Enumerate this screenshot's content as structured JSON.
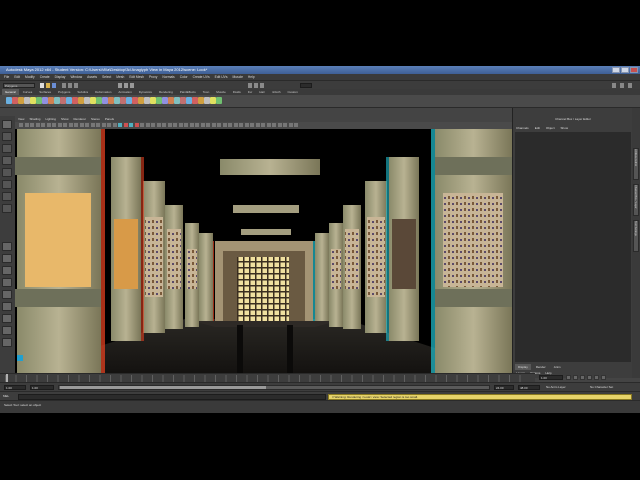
{
  "window": {
    "title": "Autodesk Maya 2012 x64 - Student Version: C:\\Users\\Villa\\Desktop\\3d Anaglyph View in Maya 2012\\scene: Look*"
  },
  "menubar": [
    "File",
    "Edit",
    "Modify",
    "Create",
    "Display",
    "Window",
    "Assets",
    "Select",
    "Mesh",
    "Edit Mesh",
    "Proxy",
    "Normals",
    "Color",
    "Create UVs",
    "Edit UVs",
    "Muscle",
    "Help"
  ],
  "statusline": {
    "mode": "Polygons"
  },
  "shelf": {
    "tabs": [
      "General",
      "Curves",
      "Surfaces",
      "Polygons",
      "Subdivs",
      "Deformation",
      "Animation",
      "Dynamics",
      "Rendering",
      "PaintEffects",
      "Toon",
      "Muscle",
      "Fluids",
      "Fur",
      "Hair",
      "nCloth",
      "Custom"
    ],
    "active_tab": "General"
  },
  "panel_menu": [
    "View",
    "Shading",
    "Lighting",
    "Show",
    "Renderer",
    "Stereo",
    "Panels"
  ],
  "channel_box": {
    "title": "Channel Box / Layer Editor",
    "menu": [
      "Channels",
      "Edit",
      "Object",
      "Show"
    ],
    "layer_tabs": [
      "Display",
      "Render",
      "Anim"
    ],
    "active_layer_tab": "Display",
    "layer_menu": [
      "Layers",
      "Options",
      "Help"
    ]
  },
  "side_tabs": [
    "Attribute Editor",
    "Channel Box / Layer Editor",
    "Tool Settings"
  ],
  "time_slider": {
    "current_frame": "1.00",
    "playhead": 0.0
  },
  "range_slider": {
    "start": "1.00",
    "start_inner": "1.00",
    "end_inner": "24.00",
    "end": "48.00",
    "range_fraction": 0.48,
    "anim_layer": "No Anim Layer",
    "character_set": "No Character Set"
  },
  "command_line": {
    "label": "MEL",
    "warning": "// Warning: Rendering <Look> view: Selected region is too small."
  },
  "help_line": "Select Tool: select an object",
  "colors": {
    "title_bar": "#4a6ea8",
    "ui_gray": "#444444",
    "warning_bg": "#e6d36a",
    "anaglyph_red": "#e04020",
    "anaglyph_cyan": "#20c0d0"
  }
}
